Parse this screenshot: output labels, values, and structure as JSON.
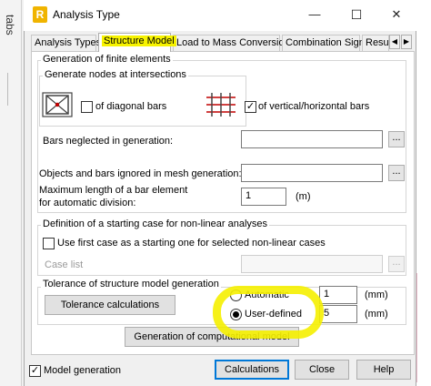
{
  "side_strip": {
    "label": "tabs"
  },
  "window": {
    "icon_letter": "R",
    "title": "Analysis Type",
    "minimize": "—",
    "maximize": "☐",
    "close": "✕"
  },
  "tabs": [
    {
      "label": "Analysis Types",
      "active": false
    },
    {
      "label": "Structure Model",
      "active": true
    },
    {
      "label": "Load to Mass Conversion",
      "active": false
    },
    {
      "label": "Combination Sign",
      "active": false
    },
    {
      "label": "Result",
      "active": false
    }
  ],
  "generation": {
    "title": "Generation of finite elements",
    "nodes": {
      "title": "Generate nodes at intersections",
      "diagonal_label": "of diagonal bars",
      "diagonal_checked": false,
      "vertical_label": "of vertical/horizontal bars",
      "vertical_checked": true
    },
    "bars_neglected_label": "Bars neglected in generation:",
    "bars_neglected_value": "",
    "objects_ignored_label": "Objects and bars ignored in mesh generation:",
    "objects_ignored_value": "",
    "max_length_label_1": "Maximum length of a bar element",
    "max_length_label_2": "for automatic division:",
    "max_length_value": "1",
    "max_length_unit": "(m)",
    "browse": "..."
  },
  "nonlinear": {
    "title": "Definition of a starting case for non-linear analyses",
    "use_first_label": "Use first case as a starting one for selected non-linear cases",
    "use_first_checked": false,
    "case_list_label": "Case list",
    "case_list_value": ""
  },
  "tolerance": {
    "title": "Tolerance of structure model generation",
    "calc_button": "Tolerance calculations",
    "automatic_label": "Automatic",
    "automatic_value": "1",
    "automatic_unit": "(mm)",
    "user_label": "User-defined",
    "user_value": "5",
    "user_unit": "(mm)",
    "selected": "user-defined"
  },
  "generate_button": "Generation of computational model",
  "footer": {
    "model_generation_label": "Model generation",
    "model_generation_checked": true,
    "calculations": "Calculations",
    "close": "Close",
    "help": "Help"
  },
  "colors": {
    "highlight": "#f5f000",
    "accent": "#0078d7",
    "bars_red": "#c00000"
  }
}
